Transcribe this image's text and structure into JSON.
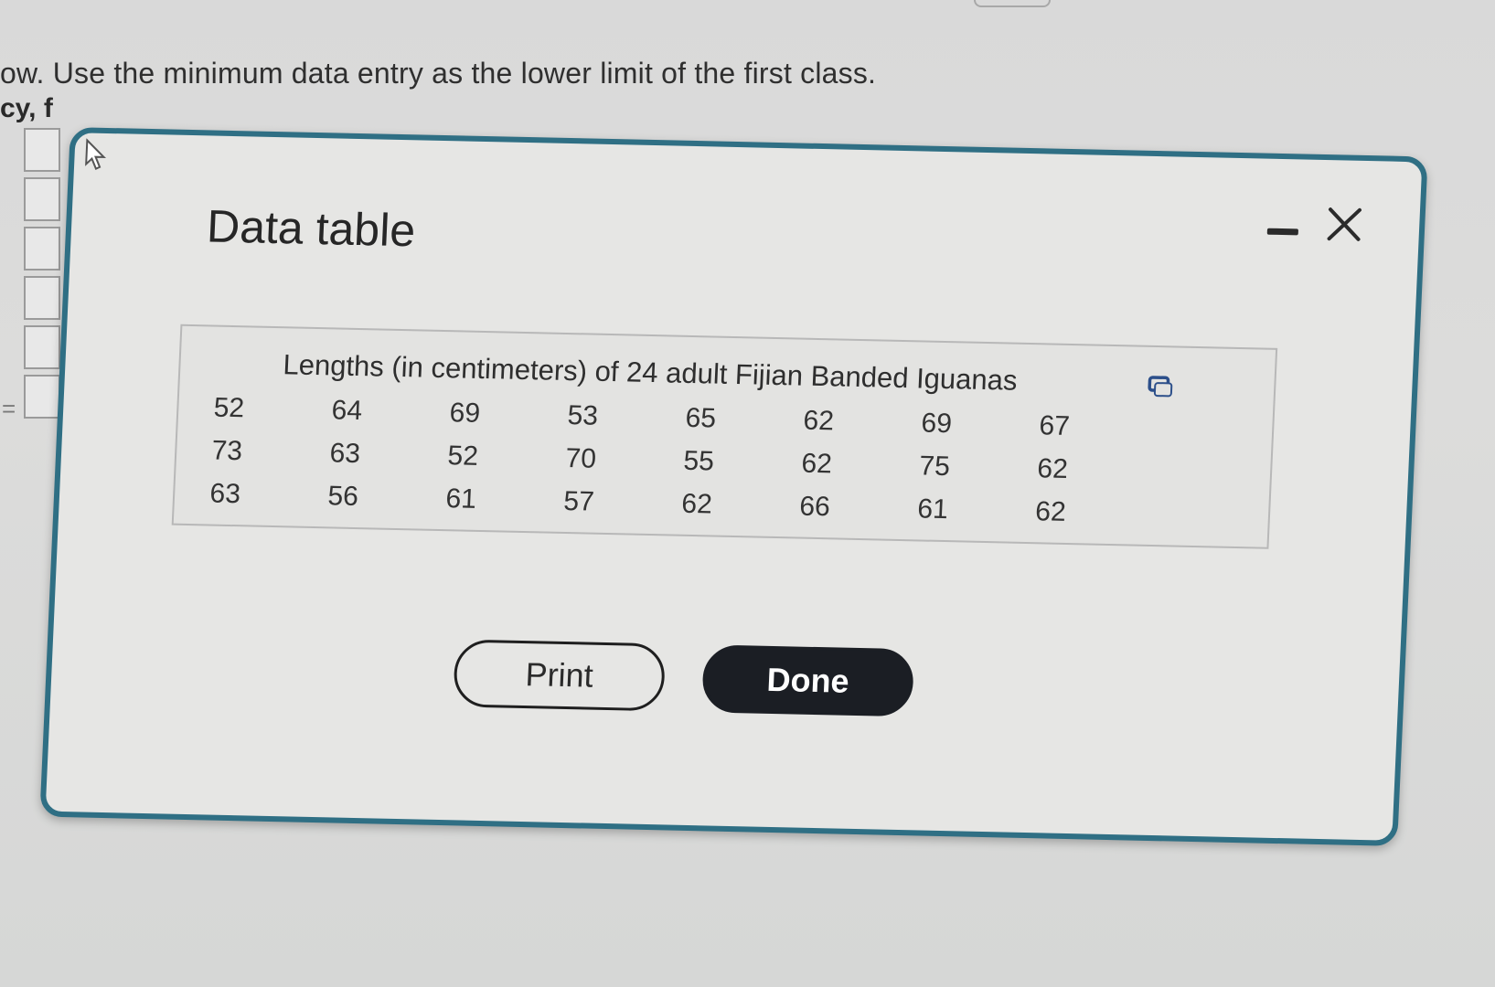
{
  "background": {
    "instruction": "ow. Use the minimum data entry as the lower limit of the first class.",
    "frequency_label": "cy, f",
    "equals_sign": "="
  },
  "dialog": {
    "title": "Data table",
    "table": {
      "caption": "Lengths (in centimeters) of 24 adult Fijian Banded Iguanas",
      "rows": [
        [
          "52",
          "64",
          "69",
          "53",
          "65",
          "62",
          "69",
          "67"
        ],
        [
          "73",
          "63",
          "52",
          "70",
          "55",
          "62",
          "75",
          "62"
        ],
        [
          "63",
          "56",
          "61",
          "57",
          "62",
          "66",
          "61",
          "62"
        ]
      ]
    },
    "buttons": {
      "print_label": "Print",
      "done_label": "Done"
    },
    "icons": {
      "minimize": "minimize-icon",
      "close": "close-icon",
      "copy": "copy-icon",
      "cursor": "mouse-cursor-icon"
    },
    "colors": {
      "border": "#2f6f84",
      "done_button": "#1b1e24"
    }
  }
}
